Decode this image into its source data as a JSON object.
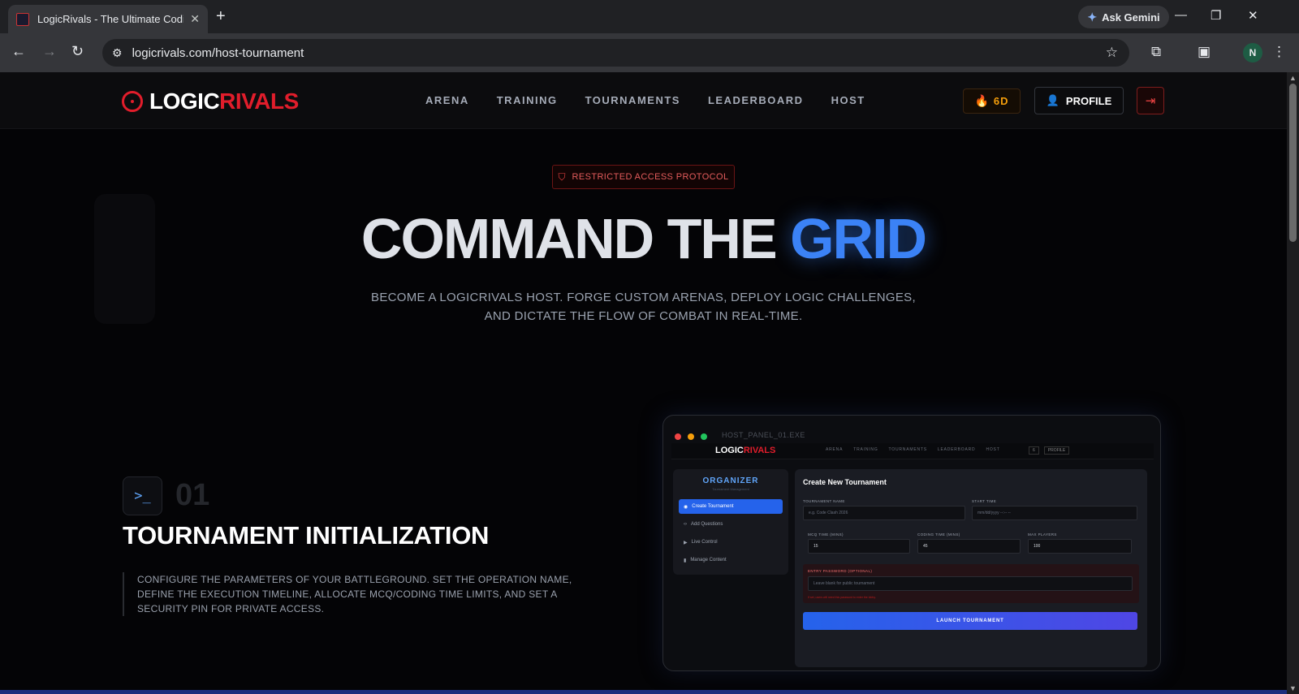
{
  "browser": {
    "tab_title": "LogicRivals - The Ultimate Codi",
    "tab_close": "✕",
    "new_tab": "+",
    "url": "logicrivals.com/host-tournament",
    "gemini_label": "Ask Gemini",
    "profile_initial": "N"
  },
  "nav": {
    "logo_part1": "LOGIC",
    "logo_part2": "RIVALS",
    "links": [
      "ARENA",
      "TRAINING",
      "TOURNAMENTS",
      "LEADERBOARD",
      "HOST"
    ],
    "streak": "6D",
    "profile_label": "PROFILE"
  },
  "hero": {
    "badge": "RESTRICTED ACCESS PROTOCOL",
    "title_part1": "COMMAND THE ",
    "title_part2": "GRID",
    "subtitle": "BECOME A LOGICRIVALS HOST. FORGE CUSTOM ARENAS, DEPLOY LOGIC CHALLENGES, AND DICTATE THE FLOW OF COMBAT IN REAL-TIME."
  },
  "step": {
    "icon_text": ">_",
    "number": "01",
    "title": "TOURNAMENT INITIALIZATION",
    "description": "CONFIGURE THE PARAMETERS OF YOUR BATTLEGROUND. SET THE OPERATION NAME, DEFINE THE EXECUTION TIMELINE, ALLOCATE MCQ/CODING TIME LIMITS, AND SET A SECURITY PIN FOR PRIVATE ACCESS."
  },
  "mockup": {
    "window_title": "HOST_PANEL_01.EXE",
    "logo_part1": "LOGIC",
    "logo_part2": "RIVALS",
    "nav_links": [
      "ARENA",
      "TRAINING",
      "TOURNAMENTS",
      "LEADERBOARD",
      "HOST"
    ],
    "nav_streak": "6",
    "nav_profile": "PROFILE",
    "sidebar_title": "ORGANIZER",
    "sidebar_subtitle": "Tournament Management",
    "sidebar_items": [
      "Create Tournament",
      "Add Questions",
      "Live Control",
      "Manage Content"
    ],
    "form_title": "Create New Tournament",
    "name_label": "TOURNAMENT NAME",
    "name_placeholder": "e.g. Code Clash 2026",
    "start_label": "START TIME",
    "start_placeholder": "mm/dd/yyyy --:-- --",
    "mcq_label": "MCQ TIME (MINS)",
    "mcq_value": "15",
    "coding_label": "CODING TIME (MINS)",
    "coding_value": "45",
    "max_label": "MAX PLAYERS",
    "max_value": "100",
    "password_label": "ENTRY PASSWORD (OPTIONAL)",
    "password_placeholder": "Leave blank for public tournament",
    "password_hint": "If set, users will need this password to enter the lobby.",
    "launch_label": "LAUNCH TOURNAMENT"
  },
  "colors": {
    "accent_red": "#e11d2b",
    "accent_blue": "#3b82f6",
    "streak_orange": "#f59e0b"
  }
}
